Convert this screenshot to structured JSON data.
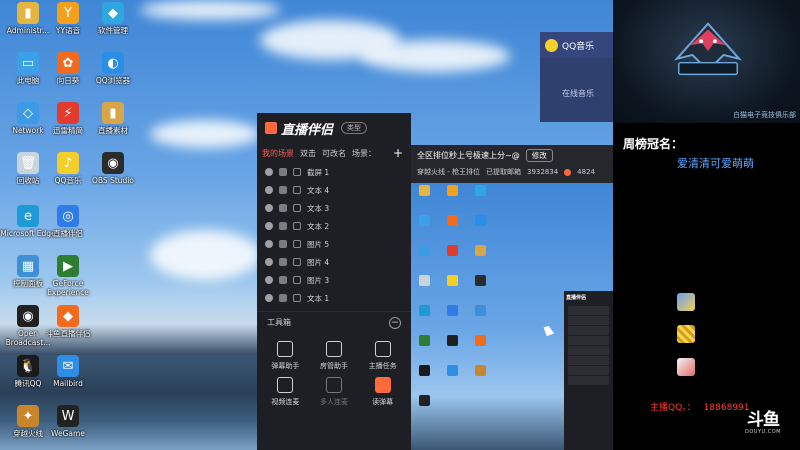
{
  "desktop": {
    "icons": [
      {
        "label": "Administr...",
        "color": "#e3b541",
        "glyph": "▮"
      },
      {
        "label": "YY语音",
        "color": "#f3a01d",
        "glyph": "Y"
      },
      {
        "label": "软件管理",
        "color": "#2ea7e0",
        "glyph": "◆"
      },
      {
        "label": "此电脑",
        "color": "#3aa0e8",
        "glyph": "▭"
      },
      {
        "label": "向日葵",
        "color": "#f26b1d",
        "glyph": "✿"
      },
      {
        "label": "QQ浏览器",
        "color": "#2a8de8",
        "glyph": "◐"
      },
      {
        "label": "Network",
        "color": "#3c9be6",
        "glyph": "◇"
      },
      {
        "label": "迅雷精简",
        "color": "#e03b2c",
        "glyph": "⚡"
      },
      {
        "label": "直播素材",
        "color": "#d8a548",
        "glyph": "▮"
      },
      {
        "label": "回收站",
        "color": "#c9d4de",
        "glyph": "🗑"
      },
      {
        "label": "QQ音乐",
        "color": "#f4cf2b",
        "glyph": "♪"
      },
      {
        "label": "OBS Studio",
        "color": "#2b2b2b",
        "glyph": "◉"
      },
      {
        "label": "Microsoft Edge",
        "color": "#1e9ad6",
        "glyph": "e"
      },
      {
        "label": "直播伴侣",
        "color": "#2f7be8",
        "glyph": "◎"
      },
      {
        "label": "控制面板",
        "color": "#3d8fd6",
        "glyph": "▦"
      },
      {
        "label": "GeForce Experience",
        "color": "#2e7d32",
        "glyph": "▶"
      },
      {
        "label": "Open Broadcast...",
        "color": "#202020",
        "glyph": "◉"
      },
      {
        "label": "斗鱼直播伴侣",
        "color": "#f26b1d",
        "glyph": "◆"
      },
      {
        "label": "腾讯QQ",
        "color": "#1a1a1a",
        "glyph": "🐧"
      },
      {
        "label": "Mailbird",
        "color": "#2e8ee6",
        "glyph": "✉"
      },
      {
        "label": "穿越火线",
        "color": "#c7862b",
        "glyph": "✦"
      },
      {
        "label": "WeGame",
        "color": "#222222",
        "glyph": "W"
      }
    ]
  },
  "qq_music": {
    "title": "QQ音乐",
    "tab": "在线音乐"
  },
  "companion": {
    "brand": "直播伴侣",
    "type_button": "类型",
    "tabs": [
      {
        "label": "我的场景"
      },
      {
        "label": "双击"
      },
      {
        "label": "可改名"
      },
      {
        "label": "场景："
      }
    ],
    "add_label": "+",
    "scenes": [
      "截屏 1",
      "文本 4",
      "文本 3",
      "文本 2",
      "图片 5",
      "图片 4",
      "图片 3",
      "文本 1"
    ],
    "toolbox_label": "工具箱",
    "minimize_label": "−",
    "tools": [
      {
        "label": "弹幕助手"
      },
      {
        "label": "房管助手"
      },
      {
        "label": "主播任务"
      },
      {
        "label": "视频连麦"
      },
      {
        "label": "多人连麦"
      },
      {
        "label": "读弹幕"
      }
    ]
  },
  "preview": {
    "status_line": "全区排位秒上号极速上分~@",
    "edit_button": "修改",
    "room_info": "穿越火线 - 枪王排位",
    "followers_label": "已提取邮箱",
    "viewer_count": "3932834",
    "hot_count": "4824"
  },
  "overlay": {
    "brand_tag": "白猫电子竞技俱乐部",
    "weekly_title": "周榜冠名：",
    "weekly_name": "爱清清可爱萌萌",
    "qq_label": "主播QQ。：",
    "qq_number": "18868991",
    "douyu_mark": "斗鱼",
    "douyu_sub": "DOUYU.COM"
  }
}
